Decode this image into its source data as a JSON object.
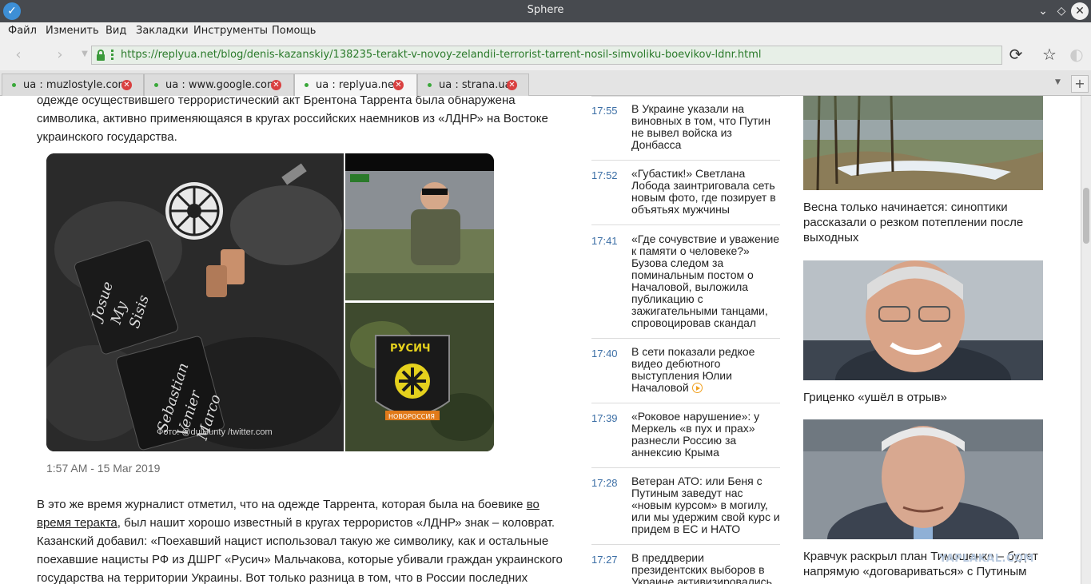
{
  "window": {
    "title": "Sphere"
  },
  "menu": [
    "Файл",
    "Изменить",
    "Вид",
    "Закладки",
    "Инструменты",
    "Помощь"
  ],
  "address": {
    "url": "https://replyua.net/blog/denis-kazanskiy/138235-terakt-v-novoy-zelandii-terrorist-tarrent-nosil-simvoliku-boevikov-ldnr.html"
  },
  "tabs": [
    {
      "label": "ua : muzlostyle.com",
      "active": false
    },
    {
      "label": "ua : www.google.com",
      "active": false
    },
    {
      "label": "ua : replyua.net",
      "active": true
    },
    {
      "label": "ua : strana.ua",
      "active": false
    }
  ],
  "article": {
    "para1": "одежде осуществившего террористический акт Брентона Таррента была обнаружена символика, активно применяющаяся в кругах российских наемников из «ЛДНР» на Востоке украинского государства.",
    "tweet": {
      "credit": "Фото: @dulHunty /twitter.com",
      "patch_text": "РУСИЧ",
      "ribbon_text": "НОВОРОССИЯ",
      "date": "1:57 AM - 15 Mar 2019"
    },
    "para2_a": "В это же время журналист отметил, что на одежде Таррента, которая была на боевике ",
    "para2_link": "во время теракта",
    "para2_b": ", был нашит хорошо известный в кругах террористов «ЛДНР» знак – коловрат. Казанский добавил: «Поехавший нацист использовал такую же символику, как и остальные поехавшие нацисты РФ из ДШРГ «Русич» Мальчакова, которые убивали граждан украинского государства на территории Украины. Вот только разница в том, что в России последних"
  },
  "news": [
    {
      "time": "17:55",
      "text": "В Украине указали на виновных в том, что Путин не вывел войска из Донбасса"
    },
    {
      "time": "17:52",
      "text": "«Губастик!» Светлана Лобода заинтриговала сеть новым фото, где позирует в объятьях мужчины"
    },
    {
      "time": "17:41",
      "text": "«Где сочувствие и уважение к памяти о человеке?» Бузова следом за поминальным постом о Началовой, выложила публикацию с зажигательными танцами, спровоцировав скандал"
    },
    {
      "time": "17:40",
      "text": "В сети показали редкое видео дебютного выступления Юлии Началовой",
      "video": true
    },
    {
      "time": "17:39",
      "text": "«Роковое нарушение»: у Меркель «в пух и прах» разнесли Россию за аннексию Крыма"
    },
    {
      "time": "17:28",
      "text": "Ветеран АТО: или Беня с Путиным заведут нас «новым курсом» в могилу, или мы удержим свой курс и придем в ЕС и НАТО"
    },
    {
      "time": "17:27",
      "text": "В преддверии президентских выборов в Украине активизировались"
    }
  ],
  "side": [
    {
      "caption": "Весна только начинается: синоптики рассказали о резком потеплении после выходных"
    },
    {
      "caption": "Гриценко «ушёл в отрыв»"
    },
    {
      "caption": "Кравчук раскрыл план Тимошенко – будет напрямую «договариваться» с Путиным"
    }
  ],
  "watermark": "YAPLAKAL.COM"
}
